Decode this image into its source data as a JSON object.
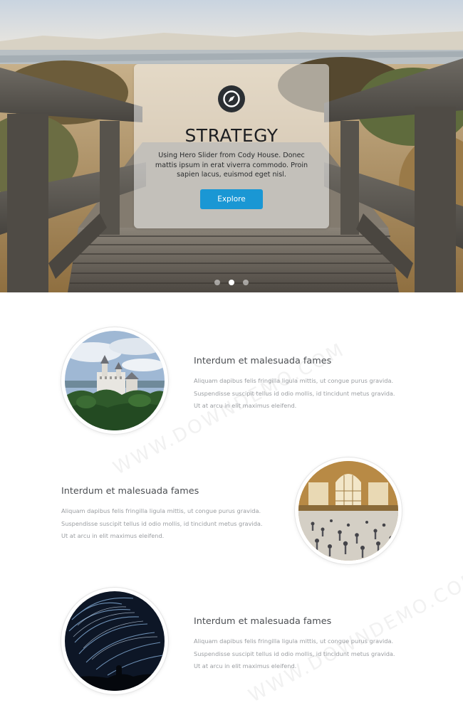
{
  "hero": {
    "title": "STRATEGY",
    "description": "Using Hero Slider from Cody House. Donec mattis ipsum in erat viverra commodo. Proin sapien lacus, euismod eget nisl.",
    "button_label": "Explore",
    "slides_count": 3,
    "active_slide": 2,
    "logo_icon": "compass-icon",
    "accent_color": "#1a97d4"
  },
  "features": [
    {
      "image": "castle-photo",
      "title": "Interdum et malesuada fames",
      "text": "Aliquam dapibus felis fringilla ligula mittis, ut congue purus gravida. Suspendisse suscipit tellus id odio mollis, id tincidunt metus gravida. Ut at arcu in elit maximus eleifend."
    },
    {
      "image": "train-station-photo",
      "title": "Interdum et malesuada fames",
      "text": "Aliquam dapibus felis fringilla ligula mittis, ut congue purus gravida. Suspendisse suscipit tellus id odio mollis, id tincidunt metus gravida. Ut at arcu in elit maximus eleifend."
    },
    {
      "image": "star-trails-photo",
      "title": "Interdum et malesuada fames",
      "text": "Aliquam dapibus felis fringilla ligula mittis, ut congue purus gravida. Suspendisse suscipit tellus id odio mollis, id tincidunt metus gravida. Ut at arcu in elit maximus eleifend."
    }
  ],
  "watermark": "WWW.DOWNDEMO.COM"
}
